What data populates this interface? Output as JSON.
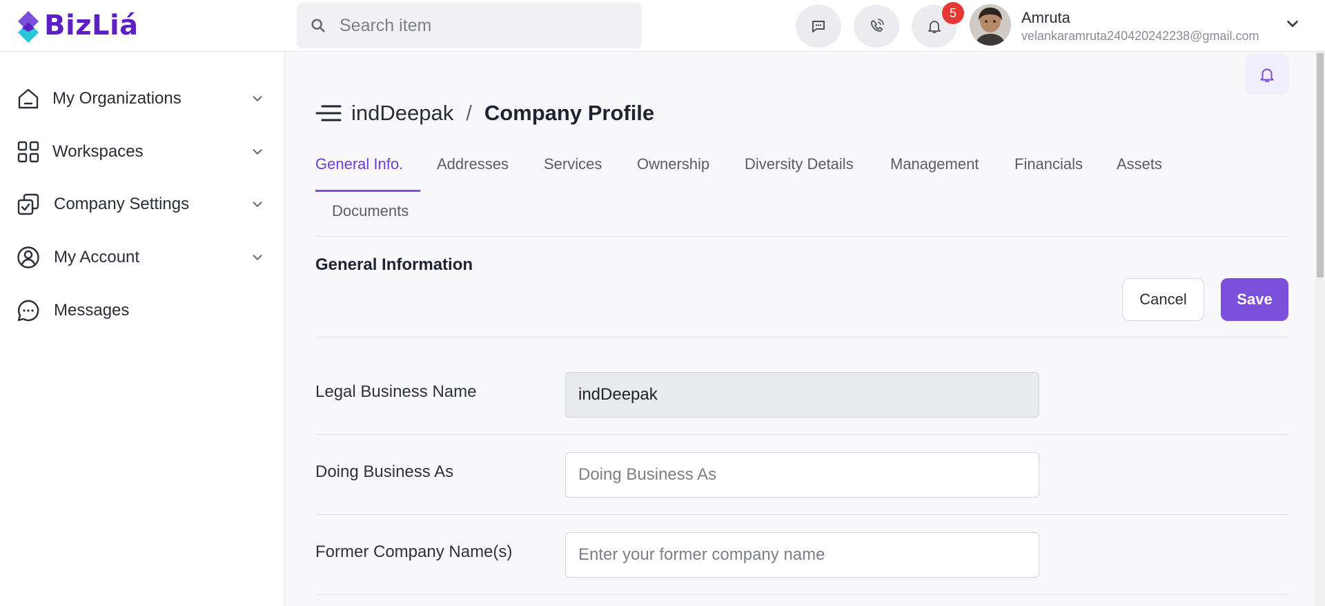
{
  "brand": {
    "name": "BizLiá"
  },
  "search": {
    "placeholder": "Search item"
  },
  "header": {
    "notification_count": "5",
    "user": {
      "name": "Amruta",
      "email": "velankaramruta240420242238@gmail.com"
    }
  },
  "sidebar": {
    "items": [
      {
        "label": "My Organizations",
        "icon": "home-icon",
        "has_dropdown": true
      },
      {
        "label": "Workspaces",
        "icon": "grid-icon",
        "has_dropdown": true
      },
      {
        "label": "Company Settings",
        "icon": "settings-check-icon",
        "has_dropdown": true
      },
      {
        "label": "My Account",
        "icon": "user-circle-icon",
        "has_dropdown": true
      },
      {
        "label": "Messages",
        "icon": "chat-icon",
        "has_dropdown": false
      }
    ]
  },
  "page": {
    "breadcrumb_org": "indDeepak",
    "separator": "/",
    "title": "Company Profile"
  },
  "tabs": [
    {
      "label": "General Info.",
      "active": true
    },
    {
      "label": "Addresses"
    },
    {
      "label": "Services"
    },
    {
      "label": "Ownership"
    },
    {
      "label": "Diversity Details"
    },
    {
      "label": "Management"
    },
    {
      "label": "Financials"
    },
    {
      "label": "Assets"
    },
    {
      "label": "Documents"
    }
  ],
  "section": {
    "title": "General Information",
    "cancel_label": "Cancel",
    "save_label": "Save"
  },
  "fields": [
    {
      "label": "Legal Business Name",
      "value": "indDeepak",
      "placeholder": "",
      "readonly": true
    },
    {
      "label": "Doing Business As",
      "value": "",
      "placeholder": "Doing Business As"
    },
    {
      "label": "Former Company Name(s)",
      "value": "",
      "placeholder": "Enter your former company name"
    }
  ],
  "colors": {
    "accent": "#7b4fd9",
    "brand": "#5b1fc4",
    "badge": "#e53935"
  }
}
